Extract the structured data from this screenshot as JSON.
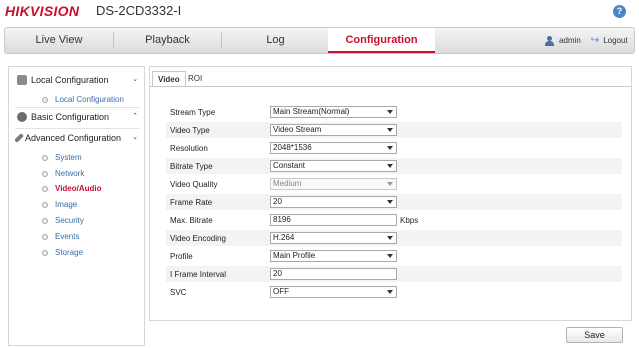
{
  "header": {
    "logo": "HIKVISION",
    "model": "DS-2CD3332-I",
    "help_icon": "?"
  },
  "nav": {
    "tabs": [
      {
        "label": "Live View"
      },
      {
        "label": "Playback"
      },
      {
        "label": "Log"
      },
      {
        "label": "Configuration"
      }
    ],
    "active_tab": "Configuration",
    "user": "admin",
    "logout": "Logout"
  },
  "sidebar": {
    "local": {
      "label": "Local Configuration",
      "items": [
        {
          "label": "Local Configuration"
        }
      ]
    },
    "basic": {
      "label": "Basic Configuration"
    },
    "advanced": {
      "label": "Advanced Configuration",
      "items": [
        {
          "label": "System"
        },
        {
          "label": "Network"
        },
        {
          "label": "Video/Audio"
        },
        {
          "label": "Image"
        },
        {
          "label": "Security"
        },
        {
          "label": "Events"
        },
        {
          "label": "Storage"
        }
      ]
    },
    "active_item": "Video/Audio"
  },
  "content": {
    "tabs": [
      {
        "label": "Video"
      },
      {
        "label": "ROI"
      }
    ],
    "active_tab": "Video",
    "fields": [
      {
        "label": "Stream Type",
        "value": "Main Stream(Normal)",
        "kind": "select"
      },
      {
        "label": "Video Type",
        "value": "Video Stream",
        "kind": "select"
      },
      {
        "label": "Resolution",
        "value": "2048*1536",
        "kind": "select"
      },
      {
        "label": "Bitrate Type",
        "value": "Constant",
        "kind": "select"
      },
      {
        "label": "Video Quality",
        "value": "Medium",
        "kind": "select",
        "disabled": true
      },
      {
        "label": "Frame Rate",
        "value": "20",
        "kind": "select"
      },
      {
        "label": "Max. Bitrate",
        "value": "8196",
        "kind": "text",
        "unit": "Kbps"
      },
      {
        "label": "Video Encoding",
        "value": "H.264",
        "kind": "select"
      },
      {
        "label": "Profile",
        "value": "Main Profile",
        "kind": "select"
      },
      {
        "label": "I Frame Interval",
        "value": "20",
        "kind": "text"
      },
      {
        "label": "SVC",
        "value": "OFF",
        "kind": "select"
      }
    ],
    "save_label": "Save"
  },
  "colors": {
    "brand_red": "#c8102e",
    "link_blue": "#3a6ea5"
  }
}
